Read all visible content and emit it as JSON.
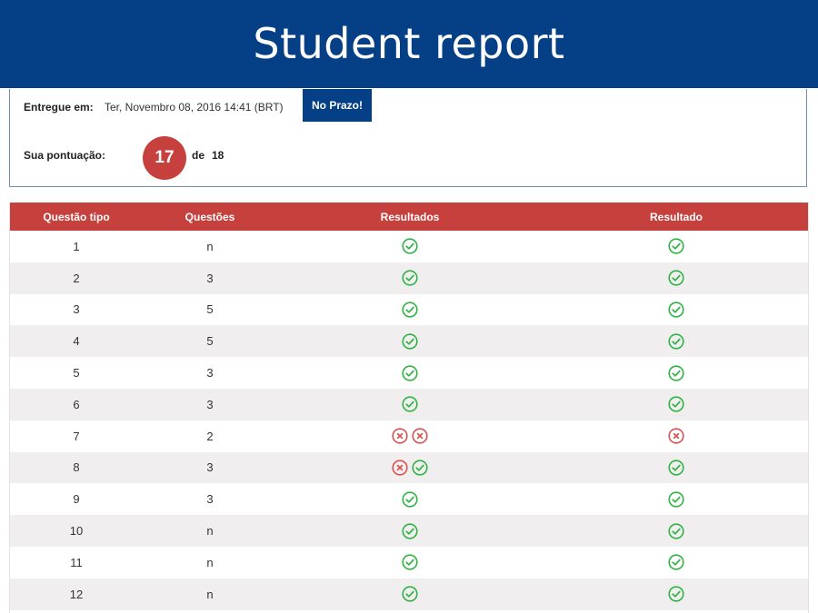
{
  "header": {
    "title": "Student report"
  },
  "submission": {
    "delivered_label": "Entregue em:",
    "delivered_value": "Ter, Novembro 08, 2016 14:41 (BRT)",
    "status_badge": "No Prazo!",
    "score_label": "Sua pontuação:",
    "score": "17",
    "score_of": "de",
    "score_total": "18"
  },
  "table": {
    "headers": [
      "Questão tipo",
      "Questões",
      "Resultados",
      "Resultado"
    ],
    "rows": [
      {
        "tipo": "1",
        "questoes": "n",
        "resultados": [
          "correct"
        ],
        "resultado": "correct"
      },
      {
        "tipo": "2",
        "questoes": "3",
        "resultados": [
          "correct"
        ],
        "resultado": "correct"
      },
      {
        "tipo": "3",
        "questoes": "5",
        "resultados": [
          "correct"
        ],
        "resultado": "correct"
      },
      {
        "tipo": "4",
        "questoes": "5",
        "resultados": [
          "correct"
        ],
        "resultado": "correct"
      },
      {
        "tipo": "5",
        "questoes": "3",
        "resultados": [
          "correct"
        ],
        "resultado": "correct"
      },
      {
        "tipo": "6",
        "questoes": "3",
        "resultados": [
          "correct"
        ],
        "resultado": "correct"
      },
      {
        "tipo": "7",
        "questoes": "2",
        "resultados": [
          "incorrect",
          "incorrect"
        ],
        "resultado": "incorrect"
      },
      {
        "tipo": "8",
        "questoes": "3",
        "resultados": [
          "incorrect",
          "correct"
        ],
        "resultado": "correct"
      },
      {
        "tipo": "9",
        "questoes": "3",
        "resultados": [
          "correct"
        ],
        "resultado": "correct"
      },
      {
        "tipo": "10",
        "questoes": "n",
        "resultados": [
          "correct"
        ],
        "resultado": "correct"
      },
      {
        "tipo": "11",
        "questoes": "n",
        "resultados": [
          "correct"
        ],
        "resultado": "correct"
      },
      {
        "tipo": "12",
        "questoes": "n",
        "resultados": [
          "correct"
        ],
        "resultado": "correct"
      }
    ]
  },
  "icons": {
    "correct": {
      "name": "check-circle-icon",
      "color": "#2fb344"
    },
    "incorrect": {
      "name": "x-circle-icon",
      "color": "#d9534f"
    }
  },
  "colors": {
    "banner": "#054086",
    "accent_red": "#c6403d",
    "row_alt": "#f1eef0"
  }
}
